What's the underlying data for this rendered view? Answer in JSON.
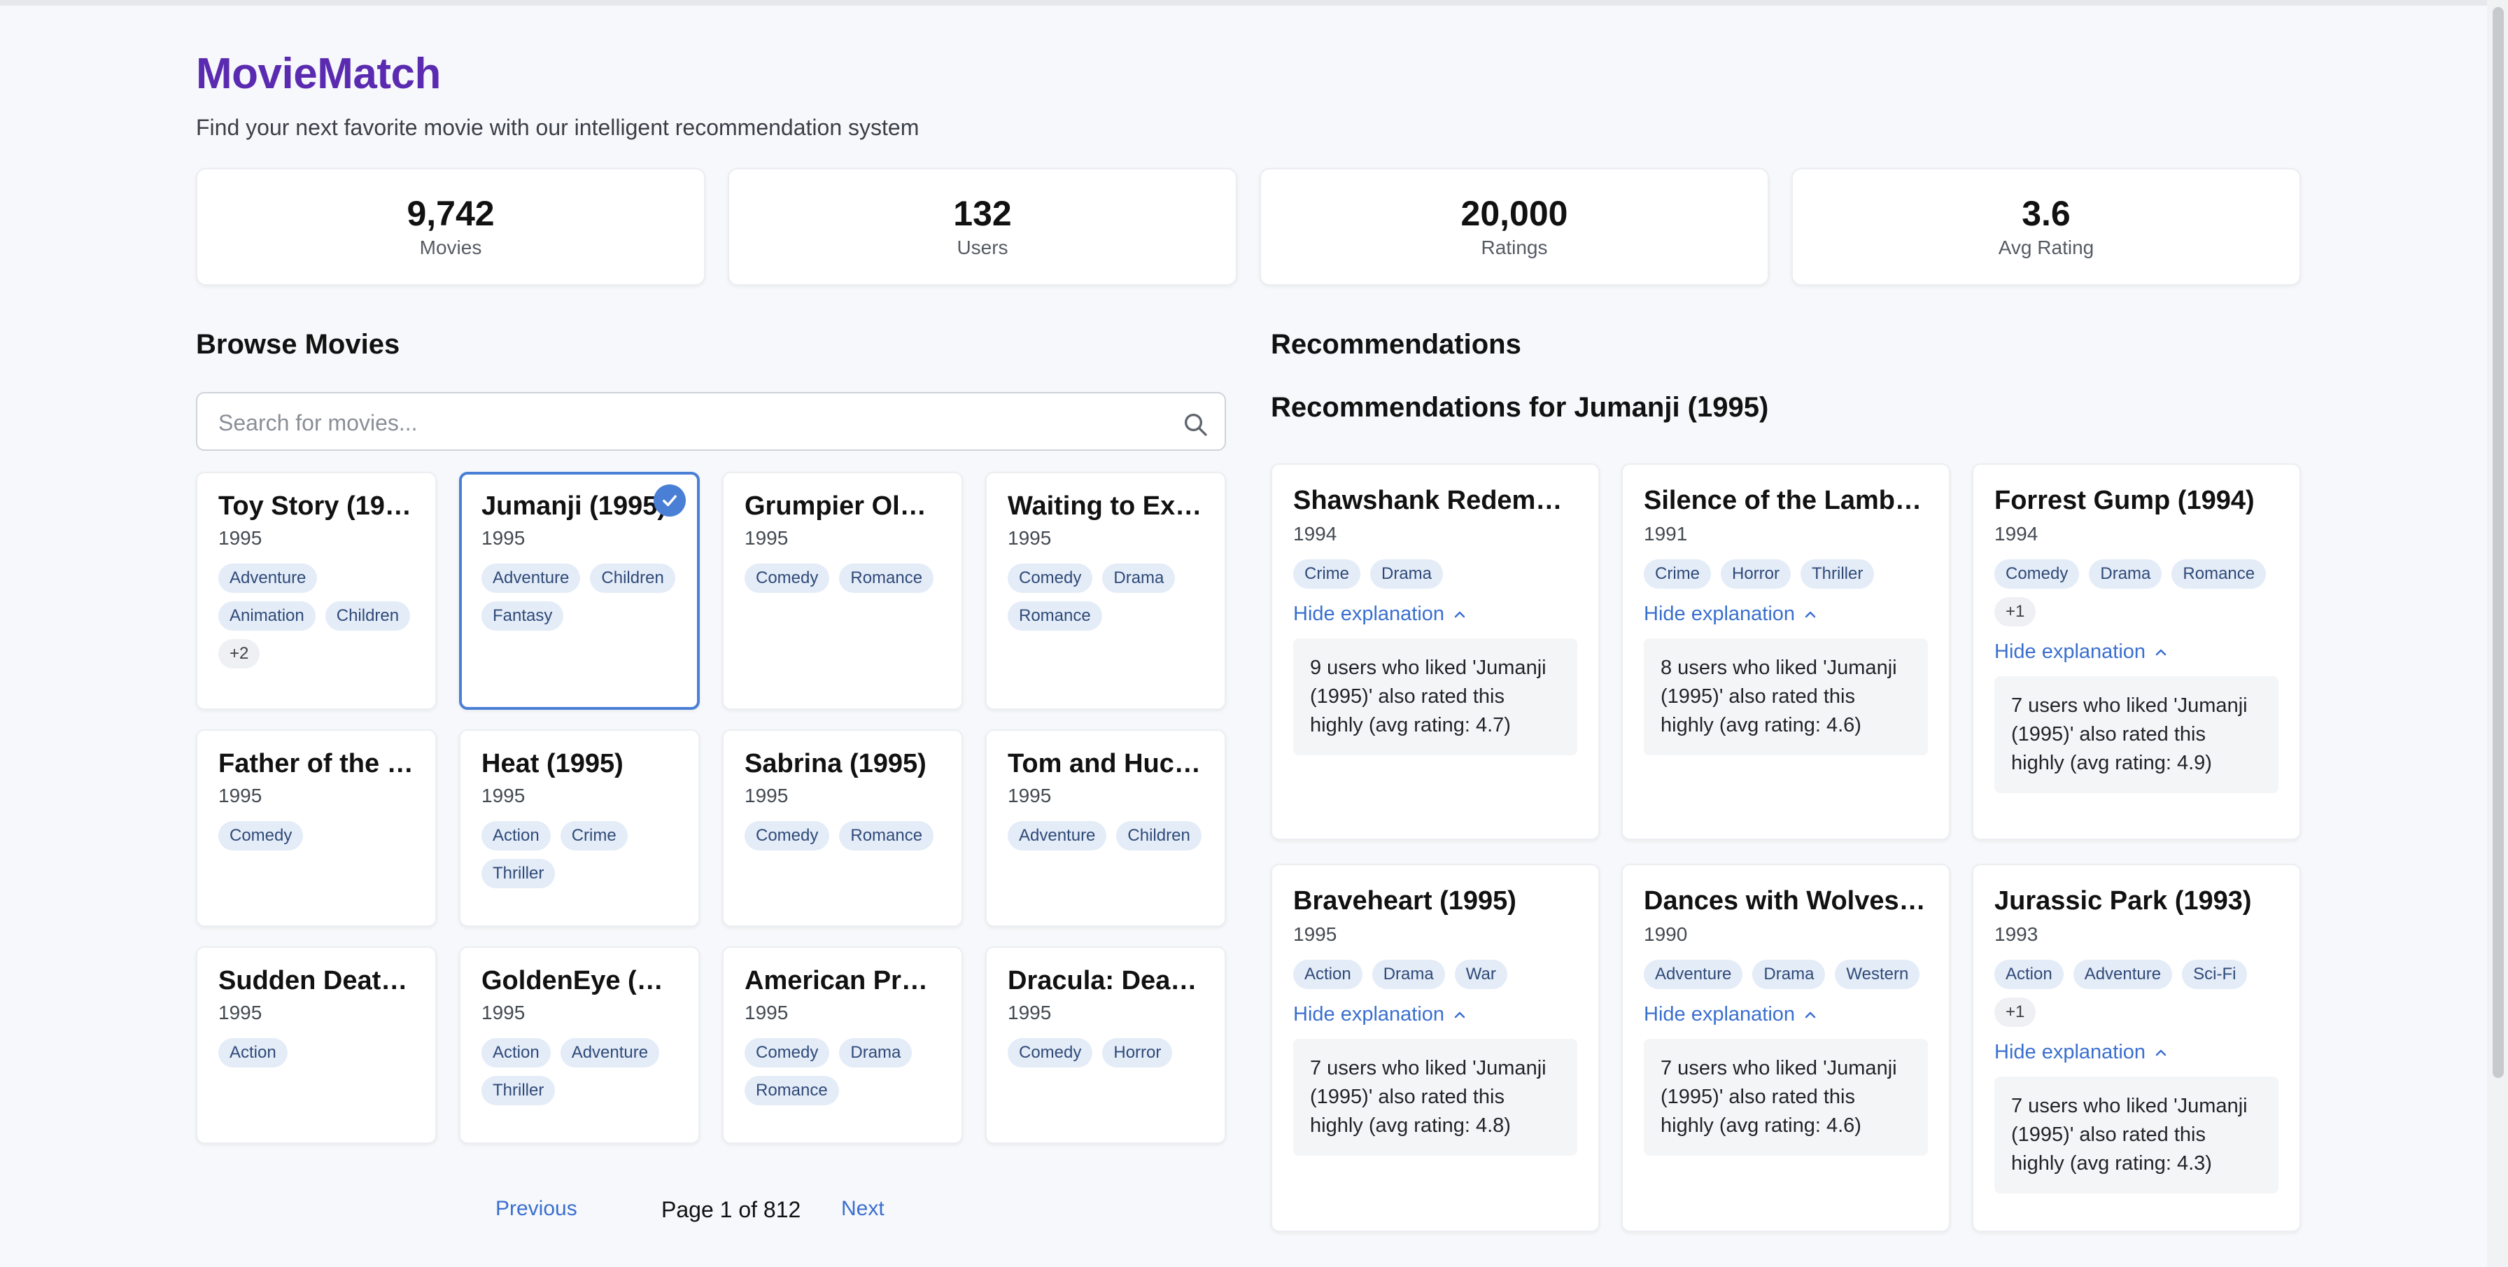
{
  "app": {
    "title": "MovieMatch",
    "subtitle": "Find your next favorite movie with our intelligent recommendation system"
  },
  "stats": [
    {
      "value": "9,742",
      "label": "Movies"
    },
    {
      "value": "132",
      "label": "Users"
    },
    {
      "value": "20,000",
      "label": "Ratings"
    },
    {
      "value": "3.6",
      "label": "Avg Rating"
    }
  ],
  "browse": {
    "title": "Browse Movies",
    "search_placeholder": "Search for movies...",
    "movies": [
      {
        "title": "Toy Story (199...",
        "year": "1995",
        "tags": [
          "Adventure",
          "Animation",
          "Children"
        ],
        "more": "+2"
      },
      {
        "title": "Jumanji (1995)",
        "year": "1995",
        "tags": [
          "Adventure",
          "Children",
          "Fantasy"
        ],
        "more": ""
      },
      {
        "title": "Grumpier Old ...",
        "year": "1995",
        "tags": [
          "Comedy",
          "Romance"
        ],
        "more": ""
      },
      {
        "title": "Waiting to Exh...",
        "year": "1995",
        "tags": [
          "Comedy",
          "Drama",
          "Romance"
        ],
        "more": ""
      },
      {
        "title": "Father of the B...",
        "year": "1995",
        "tags": [
          "Comedy"
        ],
        "more": ""
      },
      {
        "title": "Heat (1995)",
        "year": "1995",
        "tags": [
          "Action",
          "Crime",
          "Thriller"
        ],
        "more": ""
      },
      {
        "title": "Sabrina (1995)",
        "year": "1995",
        "tags": [
          "Comedy",
          "Romance"
        ],
        "more": ""
      },
      {
        "title": "Tom and Huck ...",
        "year": "1995",
        "tags": [
          "Adventure",
          "Children"
        ],
        "more": ""
      },
      {
        "title": "Sudden Death ...",
        "year": "1995",
        "tags": [
          "Action"
        ],
        "more": ""
      },
      {
        "title": "GoldenEye (19...",
        "year": "1995",
        "tags": [
          "Action",
          "Adventure",
          "Thriller"
        ],
        "more": ""
      },
      {
        "title": "American Pres...",
        "year": "1995",
        "tags": [
          "Comedy",
          "Drama",
          "Romance"
        ],
        "more": ""
      },
      {
        "title": "Dracula: Dead ...",
        "year": "1995",
        "tags": [
          "Comedy",
          "Horror"
        ],
        "more": ""
      }
    ],
    "pagination": {
      "previous": "Previous",
      "info": "Page 1 of 812",
      "next": "Next"
    }
  },
  "recommendations": {
    "title": "Recommendations",
    "subtitle": "Recommendations for Jumanji (1995)",
    "toggle_label": "Hide explanation",
    "items": [
      {
        "title": "Shawshank Redempti...",
        "year": "1994",
        "tags": [
          "Crime",
          "Drama"
        ],
        "more": "",
        "explanation": "9 users who liked 'Jumanji (1995)' also rated this highly (avg rating: 4.7)"
      },
      {
        "title": "Silence of the Lambs, ...",
        "year": "1991",
        "tags": [
          "Crime",
          "Horror",
          "Thriller"
        ],
        "more": "",
        "explanation": "8 users who liked 'Jumanji (1995)' also rated this highly (avg rating: 4.6)"
      },
      {
        "title": "Forrest Gump (1994)",
        "year": "1994",
        "tags": [
          "Comedy",
          "Drama",
          "Romance"
        ],
        "more": "+1",
        "explanation": "7 users who liked 'Jumanji (1995)' also rated this highly (avg rating: 4.9)"
      },
      {
        "title": "Braveheart (1995)",
        "year": "1995",
        "tags": [
          "Action",
          "Drama",
          "War"
        ],
        "more": "",
        "explanation": "7 users who liked 'Jumanji (1995)' also rated this highly (avg rating: 4.8)"
      },
      {
        "title": "Dances with Wolves (...",
        "year": "1990",
        "tags": [
          "Adventure",
          "Drama",
          "Western"
        ],
        "more": "",
        "explanation": "7 users who liked 'Jumanji (1995)' also rated this highly (avg rating: 4.6)"
      },
      {
        "title": "Jurassic Park (1993)",
        "year": "1993",
        "tags": [
          "Action",
          "Adventure",
          "Sci-Fi"
        ],
        "more": "+1",
        "explanation": "7 users who liked 'Jumanji (1995)' also rated this highly (avg rating: 4.3)"
      }
    ]
  }
}
